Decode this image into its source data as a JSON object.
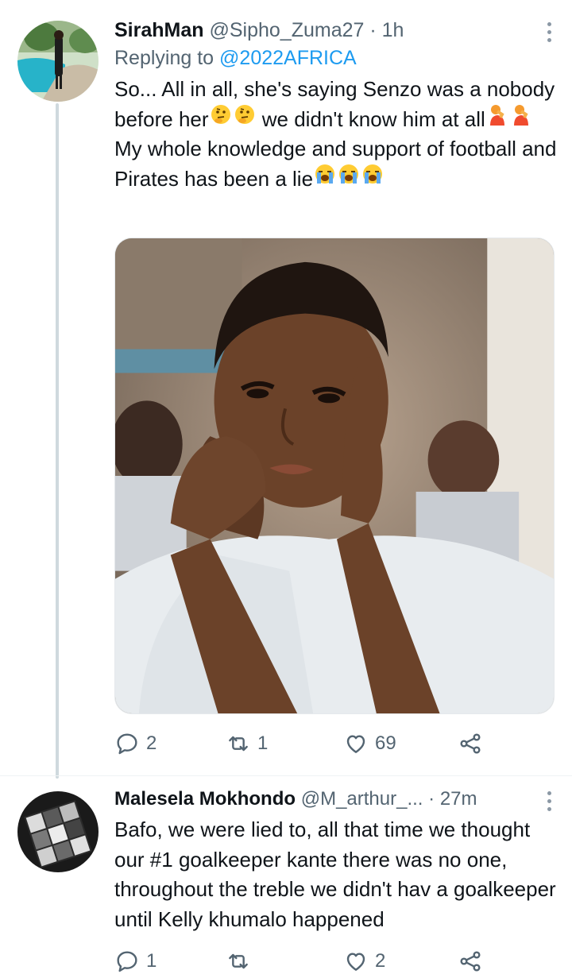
{
  "tweets": [
    {
      "display_name": "SirahMan",
      "handle": "@Sipho_Zuma27",
      "separator": "·",
      "time": "1h",
      "replying_prefix": "Replying to",
      "replying_to": "@2022AFRICA",
      "text_parts": [
        "So... All in all, she's saying Senzo was a nobody before her",
        "we didn't know him at all",
        "My whole knowledge and support of football and Pirates has been a lie"
      ],
      "emojis": [
        "thinking-face-emoji",
        "facepalm-emoji",
        "crying-face-emoji"
      ],
      "replies": "2",
      "retweets": "1",
      "likes": "69"
    },
    {
      "display_name": "Malesela Mokhondo",
      "handle": "@M_arthur_...",
      "separator": "·",
      "time": "27m",
      "text": "Bafo, we were lied to, all that time we thought our #1 goalkeeper kante there was no one, throughout the treble we didn't hav a goalkeeper until Kelly khumalo happened",
      "replies": "1",
      "retweets": "",
      "likes": "2"
    }
  ],
  "colors": {
    "text": "#0f1419",
    "muted": "#536471",
    "link": "#1d9bf0",
    "thread_line": "#cfd9de"
  },
  "icons": [
    "reply-icon",
    "retweet-icon",
    "like-icon",
    "share-icon",
    "more-icon"
  ]
}
